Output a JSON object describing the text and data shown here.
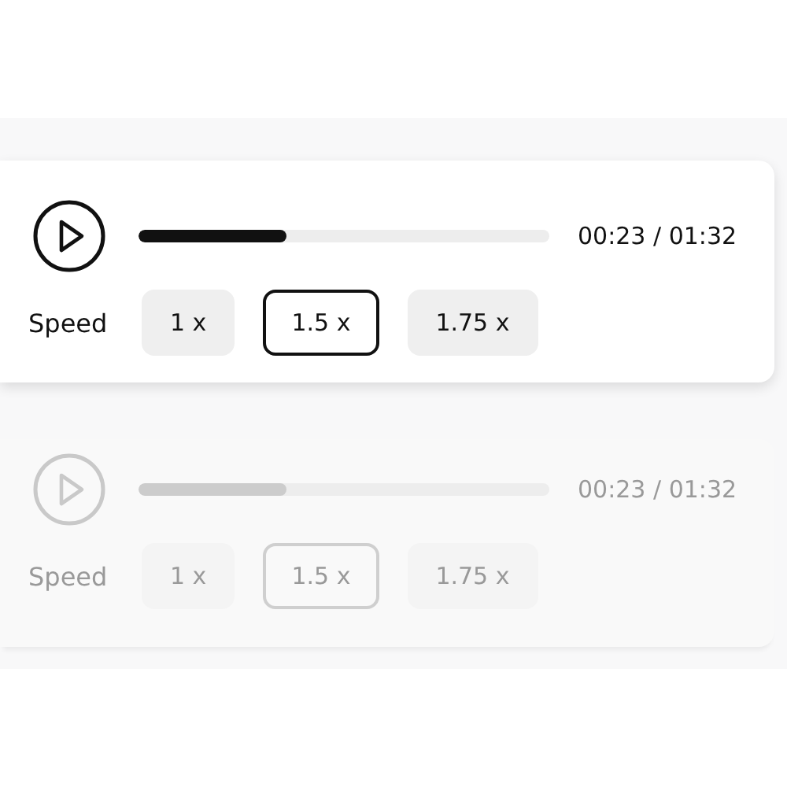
{
  "players": [
    {
      "disabled": false,
      "level": 0.36,
      "time": "00:23 / 01:32",
      "speed_label": "Speed",
      "speeds": [
        {
          "label": "1 x",
          "selected": false
        },
        {
          "label": "1.5 x",
          "selected": true
        },
        {
          "label": "1.75 x",
          "selected": false
        }
      ]
    },
    {
      "disabled": true,
      "level": 0.36,
      "time": "00:23 / 01:32",
      "speed_label": "Speed",
      "speeds": [
        {
          "label": "1 x",
          "selected": false
        },
        {
          "label": "1.5 x",
          "selected": true
        },
        {
          "label": "1.75 x",
          "selected": false
        }
      ]
    }
  ]
}
